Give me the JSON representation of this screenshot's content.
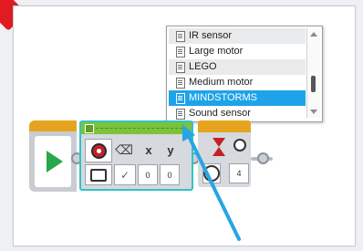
{
  "dropdown": {
    "items": [
      {
        "label": "IR sensor",
        "style": "alt"
      },
      {
        "label": "Large motor",
        "style": ""
      },
      {
        "label": "LEGO",
        "style": "alt"
      },
      {
        "label": "Medium motor",
        "style": ""
      },
      {
        "label": "MINDSTORMS",
        "style": "selected"
      },
      {
        "label": "Sound sensor",
        "style": ""
      }
    ]
  },
  "motor_block": {
    "x_label": "x",
    "y_label": "y",
    "x_value": "0",
    "y_value": "0"
  },
  "wait_block": {
    "value": "4"
  },
  "colors": {
    "selection": "#1ea3e8",
    "start_bar": "#e6a41e",
    "block_bar": "#7cc23b",
    "highlight": "#2fc3c8",
    "arrow": "#27a6e3"
  },
  "icons": [
    "play-icon",
    "sensor-icon",
    "eraser-icon",
    "folder-icon",
    "check-icon",
    "hourglass-icon",
    "timer-icon",
    "file-icon"
  ]
}
